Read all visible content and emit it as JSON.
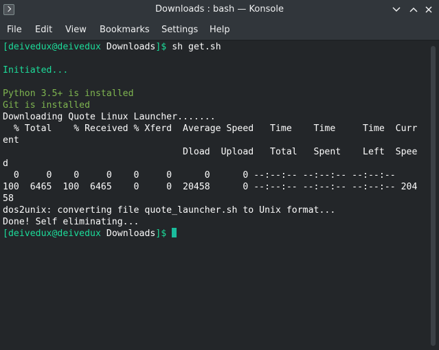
{
  "window": {
    "title": "Downloads : bash — Konsole"
  },
  "menu": [
    "File",
    "Edit",
    "View",
    "Bookmarks",
    "Settings",
    "Help"
  ],
  "prompt": {
    "open_bracket": "[",
    "user_host": "deivedux@deivedux",
    "path": "Downloads",
    "close": "]$ "
  },
  "terminal": {
    "command": "sh get.sh",
    "initiated": "Initiated...",
    "python_ok": "Python 3.5+ is installed",
    "git_ok": "Git is installed",
    "downloading": "Downloading Quote Linux Launcher.......",
    "curl_header_1a": "  % Total    % Received % Xferd  Average Speed   Time    Time     Time  Curr",
    "curl_header_1b": "ent",
    "curl_header_2a": "                                 Dload  Upload   Total   Spent    Left  Spee",
    "curl_header_2b": "d",
    "curl_progress_0": "  0     0    0     0    0     0      0      0 --:--:-- --:--:-- --:--:--",
    "curl_progress_1a": "100  6465  100  6465    0     0  20458      0 --:--:-- --:--:-- --:--:-- 204",
    "curl_progress_1b": "58",
    "dos2unix": "dos2unix: converting file quote_launcher.sh to Unix format...",
    "done": "Done! Self eliminating..."
  },
  "colors": {
    "background": "#232629",
    "prompt": "#1cdc9a",
    "cursor": "#1abc9c",
    "status_ok": "#7fb550"
  }
}
